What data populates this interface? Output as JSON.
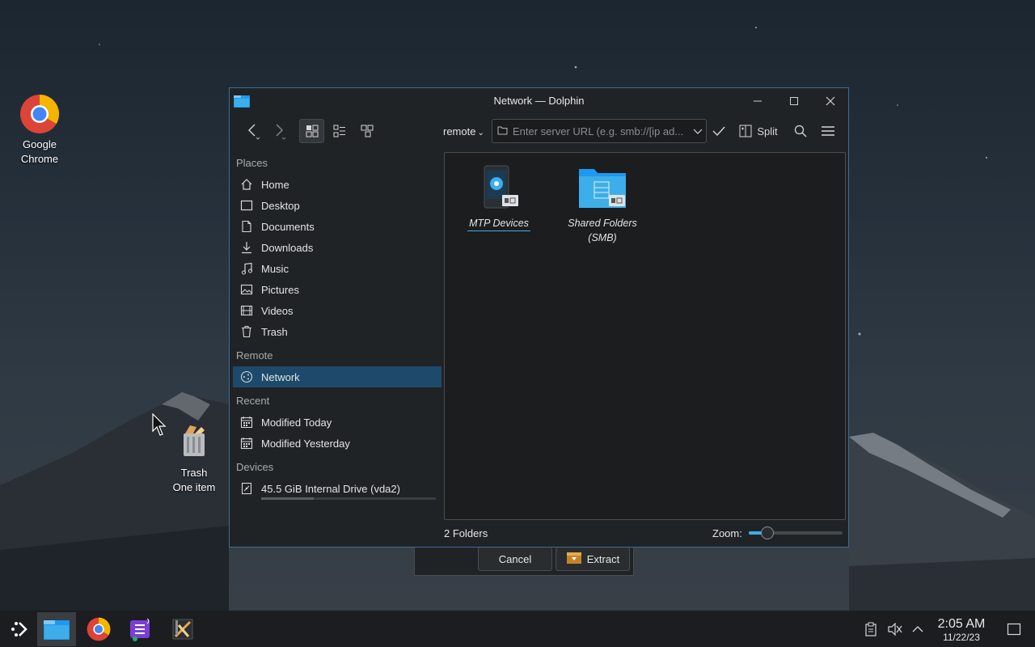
{
  "desktop": {
    "icons": [
      {
        "label_line1": "Google",
        "label_line2": "Chrome"
      },
      {
        "label_line1": "Trash",
        "label_line2": "One item"
      }
    ]
  },
  "window": {
    "title": "Network — Dolphin",
    "toolbar": {
      "breadcrumb": "remote",
      "url_placeholder": "Enter server URL (e.g. smb://[ip ad...",
      "split_label": "Split"
    },
    "places": {
      "sections": [
        {
          "title": "Places",
          "items": [
            {
              "label": "Home",
              "icon": "home-icon"
            },
            {
              "label": "Desktop",
              "icon": "desktop-icon"
            },
            {
              "label": "Documents",
              "icon": "documents-icon"
            },
            {
              "label": "Downloads",
              "icon": "downloads-icon"
            },
            {
              "label": "Music",
              "icon": "music-icon"
            },
            {
              "label": "Pictures",
              "icon": "pictures-icon"
            },
            {
              "label": "Videos",
              "icon": "videos-icon"
            },
            {
              "label": "Trash",
              "icon": "trash-icon"
            }
          ]
        },
        {
          "title": "Remote",
          "items": [
            {
              "label": "Network",
              "icon": "network-icon",
              "active": true
            }
          ]
        },
        {
          "title": "Recent",
          "items": [
            {
              "label": "Modified Today",
              "icon": "calendar-icon"
            },
            {
              "label": "Modified Yesterday",
              "icon": "calendar-icon"
            }
          ]
        },
        {
          "title": "Devices",
          "items": [
            {
              "label": "45.5 GiB Internal Drive (vda2)",
              "icon": "drive-icon"
            }
          ]
        }
      ]
    },
    "content": {
      "items": [
        {
          "label_line1": "MTP Devices",
          "label_line2": ""
        },
        {
          "label_line1": "Shared Folders",
          "label_line2": "(SMB)"
        }
      ]
    },
    "status": {
      "count": "2 Folders",
      "zoom_label": "Zoom:",
      "zoom_level": 0.2
    }
  },
  "dialog": {
    "cancel_label": "Cancel",
    "extract_label": "Extract"
  },
  "taskbar": {
    "time": "2:05 AM",
    "date": "11/22/23"
  },
  "colors": {
    "accent": "#3daee9",
    "selection": "#1d4a6b",
    "window_bg": "#202326"
  }
}
